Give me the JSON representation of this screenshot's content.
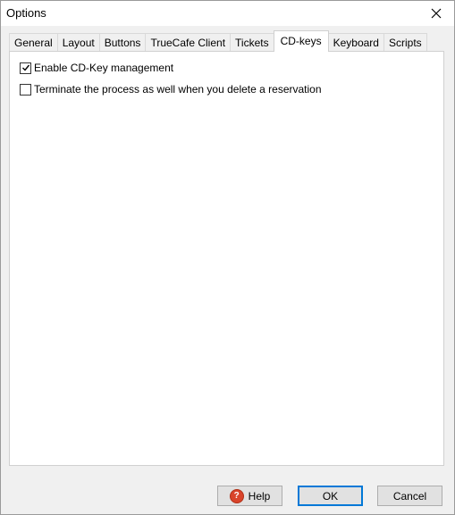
{
  "window": {
    "title": "Options"
  },
  "tabs": [
    {
      "label": "General"
    },
    {
      "label": "Layout"
    },
    {
      "label": "Buttons"
    },
    {
      "label": "TrueCafe Client"
    },
    {
      "label": "Tickets"
    },
    {
      "label": "CD-keys"
    },
    {
      "label": "Keyboard"
    },
    {
      "label": "Scripts"
    }
  ],
  "active_tab": "CD-keys",
  "options": [
    {
      "label": "Enable CD-Key management",
      "checked": true
    },
    {
      "label": "Terminate the process as well when you delete a reservation",
      "checked": false
    }
  ],
  "buttons": {
    "help": "Help",
    "ok": "OK",
    "cancel": "Cancel"
  }
}
